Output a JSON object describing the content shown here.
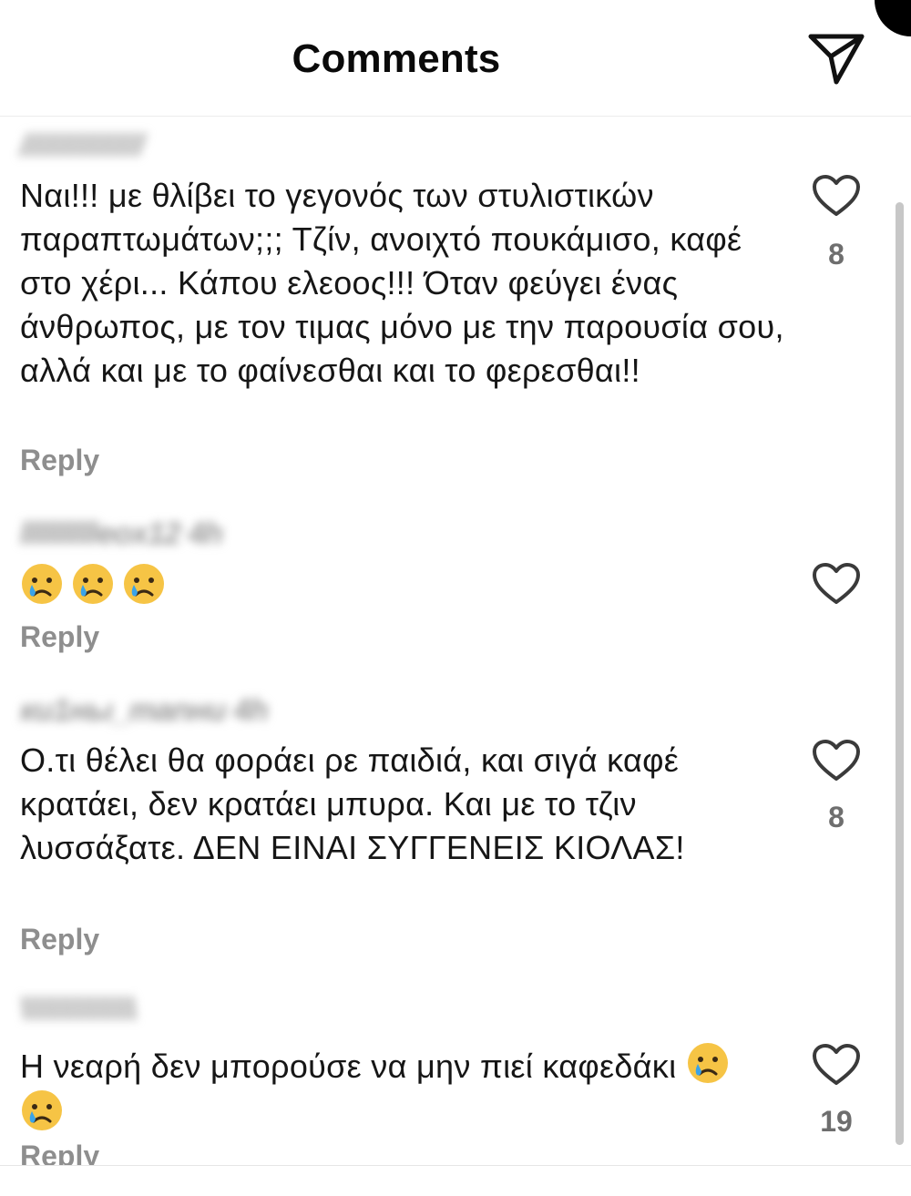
{
  "header": {
    "title": "Comments",
    "share_icon": "send-icon"
  },
  "comments": [
    {
      "username": "////////////////",
      "text": "Ναι!!! με θλίβει το γεγονός των στυλιστικών παραπτωμάτων;;; Τζίν, ανοιχτό πουκάμισο, καφέ στο χέρι... Κάπου ελεοος!!! Όταν φεύγει ένας άνθρωπος, με τον τιμας μόνο με την παρουσία σου, αλλά και με το φαίνεσθαι και το φερεσθαι!!",
      "reply": "Reply",
      "likes": "8"
    },
    {
      "username": "lllllllllleox12 4h",
      "text": "",
      "emojis": [
        "crying-face-emoji",
        "crying-face-emoji",
        "crying-face-emoji"
      ],
      "reply": "Reply",
      "likes": ""
    },
    {
      "username": "ки1ны_manни 4h",
      "text": "Ο.τι θέλει θα φοράει ρε παιδιά, και σιγά καφέ κρατάει, δεν κρατάει μπυρα. Και με το τζιν λυσσάξατε. ΔΕΝ ΕΙΝΑΙ ΣΥΓΓΕΝΕΙΣ ΚΙΟΛΑΣ!",
      "reply": "Reply",
      "likes": "8"
    },
    {
      "username": "\\\\\\\\\\\\\\\\\\\\\\\\\\\\\\",
      "text": "Η νεαρή δεν μπορούσε να μην πιεί καφεδάκι",
      "emojis": [
        "crying-face-emoji",
        "crying-face-emoji"
      ],
      "reply": "Reply",
      "likes": "19"
    }
  ],
  "colors": {
    "text": "#161616",
    "muted": "#8e8e8e",
    "count": "#6e6e6e",
    "emoji_face": "#f6c445",
    "tear": "#3aa3e8"
  }
}
